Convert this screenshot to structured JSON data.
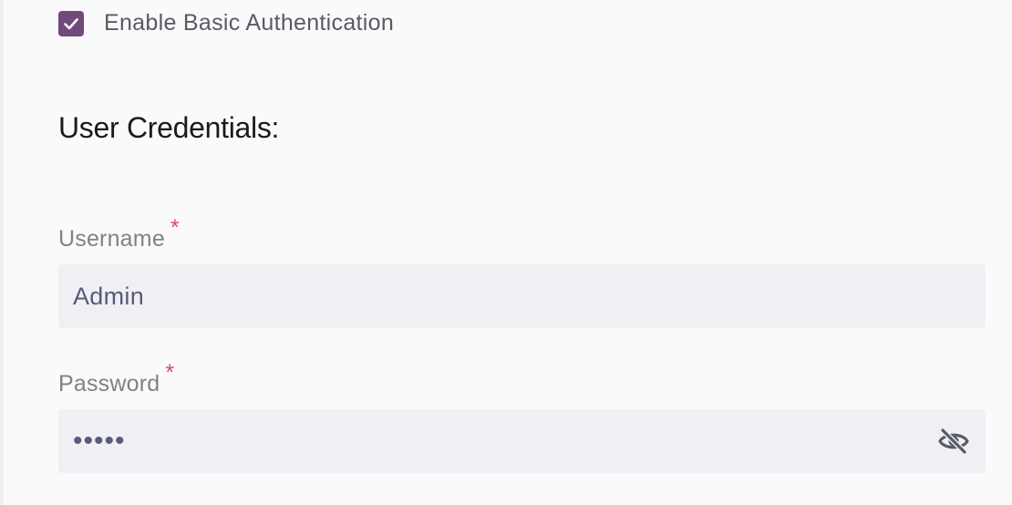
{
  "auth": {
    "checkbox_checked": true,
    "checkbox_label": "Enable Basic Authentication"
  },
  "credentials": {
    "title": "User Credentials:",
    "username": {
      "label": "Username",
      "required_mark": "*",
      "value": "Admin"
    },
    "password": {
      "label": "Password",
      "required_mark": "*",
      "masked_value": "•••••",
      "toggle_icon": "eye-off-icon"
    }
  },
  "colors": {
    "accent": "#71497a",
    "required": "#d14d6e",
    "input_bg": "#f0f0f4",
    "page_bg": "#fafafa"
  }
}
